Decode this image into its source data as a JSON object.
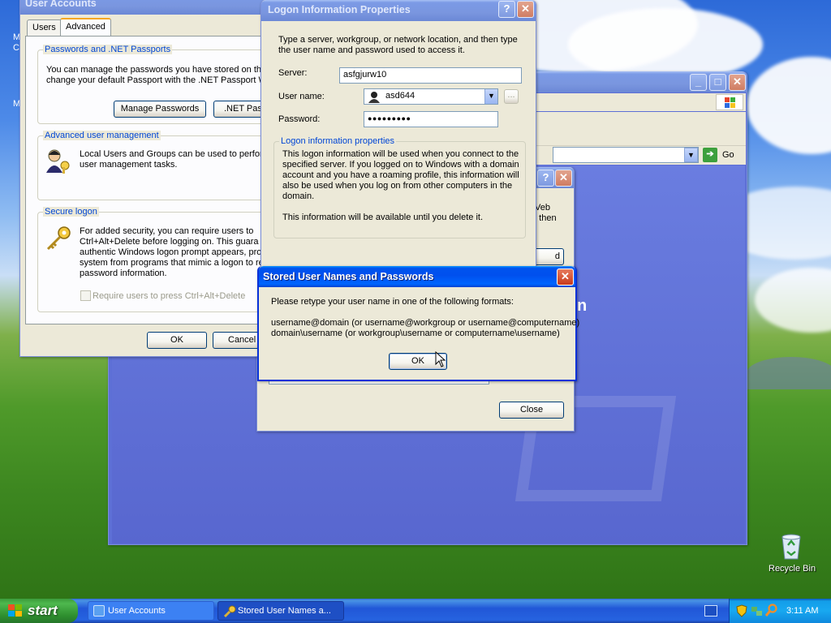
{
  "desktop": {
    "recycle_bin_label": "Recycle Bin",
    "left_edge_fragments": [
      "M",
      "C",
      "M"
    ]
  },
  "user_accounts": {
    "title": "User Accounts",
    "tabs": [
      "Users",
      "Advanced"
    ],
    "selected_tab": "Advanced",
    "passports": {
      "title": "Passwords and .NET Passports",
      "line1": "You can manage the passwords you have stored on thi",
      "line2": "change your default Passport with the .NET Passport W",
      "manage_button": "Manage Passwords",
      "net_passport_button": ".NET Pass"
    },
    "advanced_mgmt": {
      "title": "Advanced user management",
      "line1": "Local Users and Groups can be used to perform",
      "line2": "user management tasks."
    },
    "secure_logon": {
      "title": "Secure logon",
      "lines": [
        "For added security, you can require users to",
        "Ctrl+Alt+Delete before logging on. This guara",
        "authentic Windows logon prompt appears, pro",
        "system from programs that mimic a logon to re",
        "password information."
      ],
      "checkbox_label": "Require users to press Ctrl+Alt+Delete"
    },
    "ok_button": "OK",
    "cancel_button": "Cancel"
  },
  "browser": {
    "go_label": "Go"
  },
  "stored_partial": {
    "fragments": [
      "Veb",
      "d then",
      "d"
    ],
    "close_button": "Close"
  },
  "behind_fragment": "n",
  "logon_props": {
    "title": "Logon Information Properties",
    "instructions_line1": "Type a server, workgroup, or network location, and then type",
    "instructions_line2": "the user name and password used to access it.",
    "server_label": "Server:",
    "server_value": "asfgjurw10",
    "username_label": "User name:",
    "username_value": "asd644",
    "password_label": "Password:",
    "password_value": "●●●●●●●●●",
    "browse_button": "...",
    "group_title": "Logon information properties",
    "info_lines": [
      "This logon information will be used when you connect to the",
      "specified server. If you logged on to Windows with a domain",
      "account and you have a roaming profile, this information will",
      "also be used when you log on from other computers in the",
      "domain."
    ],
    "info_line2": "This information will be available until you delete it."
  },
  "message_box": {
    "title": "Stored User Names and Passwords",
    "prompt": "Please retype your user name in one of the following formats:",
    "format1": "username@domain (or username@workgroup or username@computername)",
    "format2": "domain\\username (or workgroup\\username or computername\\username)",
    "ok_button": "OK"
  },
  "taskbar": {
    "start_label": "start",
    "items": [
      "User Accounts",
      "Stored User Names a..."
    ],
    "clock": "3:11 AM"
  },
  "colors": {
    "xp_blue": "#0054e3",
    "close_red": "#c73a1c",
    "dialog_bg": "#ece9d8",
    "group_title": "#0046d5"
  }
}
